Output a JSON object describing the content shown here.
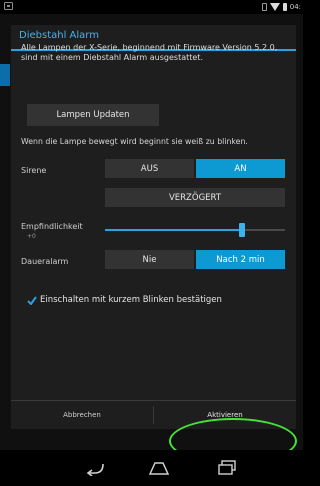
{
  "status_bar": {
    "time": "04:"
  },
  "dialog": {
    "title": "Diebstahl Alarm",
    "description": "Alle Lampen der X-Serie, beginnend mit Firmware Version 5.2.0, sind mit einem Diebstahl Alarm ausgestattet.",
    "update_button": "Lampen Updaten",
    "info_text": "Wenn die Lampe bewegt wird beginnt sie weiß zu blinken.",
    "siren": {
      "label": "Sirene",
      "options": [
        "AUS",
        "AN"
      ],
      "selected": "AN",
      "delayed_option": "VERZÖGERT"
    },
    "sensitivity": {
      "label": "Empfindlichkeit",
      "value_text": "+0",
      "level": 0.76
    },
    "continuous_alarm": {
      "label": "Daueralarm",
      "options": [
        "Nie",
        "Nach 2 min"
      ],
      "selected": "Nach 2 min"
    },
    "confirm_checkbox": {
      "label": "Einschalten mit kurzem Blinken bestätigen",
      "checked": true
    },
    "buttons": {
      "cancel": "Abbrechen",
      "activate": "Aktivieren"
    }
  },
  "colors": {
    "accent": "#2aa2de",
    "selected": "#0d99d1",
    "highlight": "#46e23a"
  },
  "icons": [
    "back-icon",
    "home-icon",
    "recents-icon",
    "wifi-icon",
    "battery-icon",
    "checkmark-icon"
  ]
}
